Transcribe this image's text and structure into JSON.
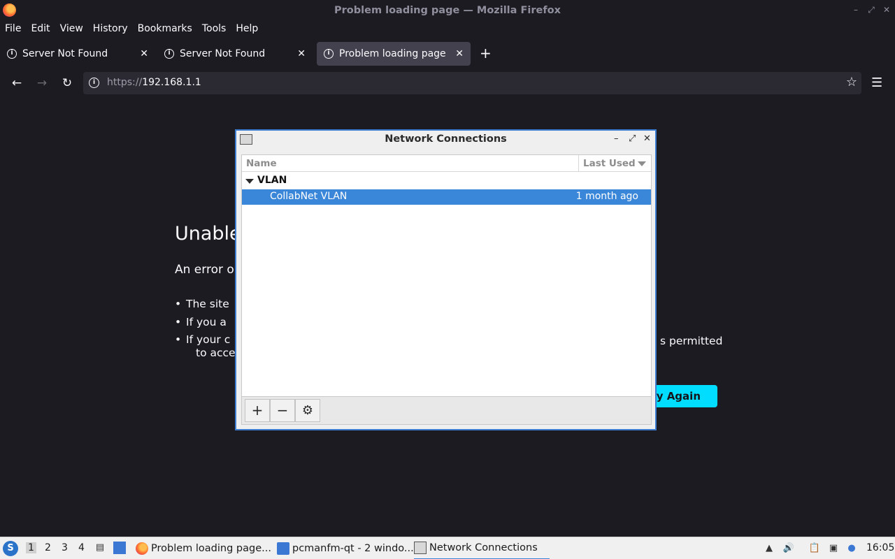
{
  "window": {
    "title": "Problem loading page — Mozilla Firefox",
    "minimize_icon": "minimize-icon",
    "maximize_icon": "maximize-icon",
    "close_icon": "close-icon"
  },
  "menubar": [
    "File",
    "Edit",
    "View",
    "History",
    "Bookmarks",
    "Tools",
    "Help"
  ],
  "tabs": [
    {
      "label": "Server Not Found",
      "active": false
    },
    {
      "label": "Server Not Found",
      "active": false
    },
    {
      "label": "Problem loading page",
      "active": true
    }
  ],
  "urlbar": {
    "scheme": "https://",
    "host": "192.168.1.1"
  },
  "page": {
    "title": "Unable",
    "desc": "An error o",
    "bullets": [
      "The site",
      "If you a",
      "If your c",
      "to acce"
    ],
    "tail_text": "s permitted",
    "try_again": "y Again"
  },
  "dialog": {
    "title": "Network Connections",
    "columns": {
      "name": "Name",
      "last_used": "Last Used"
    },
    "group": "VLAN",
    "connections": [
      {
        "name": "CollabNet VLAN",
        "last_used": "1 month ago",
        "selected": true
      }
    ],
    "buttons": {
      "add": "+",
      "remove": "−",
      "settings": "⚙"
    }
  },
  "taskbar": {
    "desktops": [
      "1",
      "2",
      "3",
      "4"
    ],
    "tasks": [
      {
        "label": "Problem loading page...",
        "icon": "firefox-icon",
        "active": false
      },
      {
        "label": "pcmanfm-qt - 2 windo...",
        "icon": "folder-icon",
        "active": false
      },
      {
        "label": "Network Connections",
        "icon": "network-icon",
        "active": true
      }
    ],
    "clock": "16:05"
  },
  "colors": {
    "accent": "#00ddff",
    "selection": "#3a86d9",
    "dialog_border": "#3d7dd1",
    "page_bg": "#1c1b22"
  }
}
